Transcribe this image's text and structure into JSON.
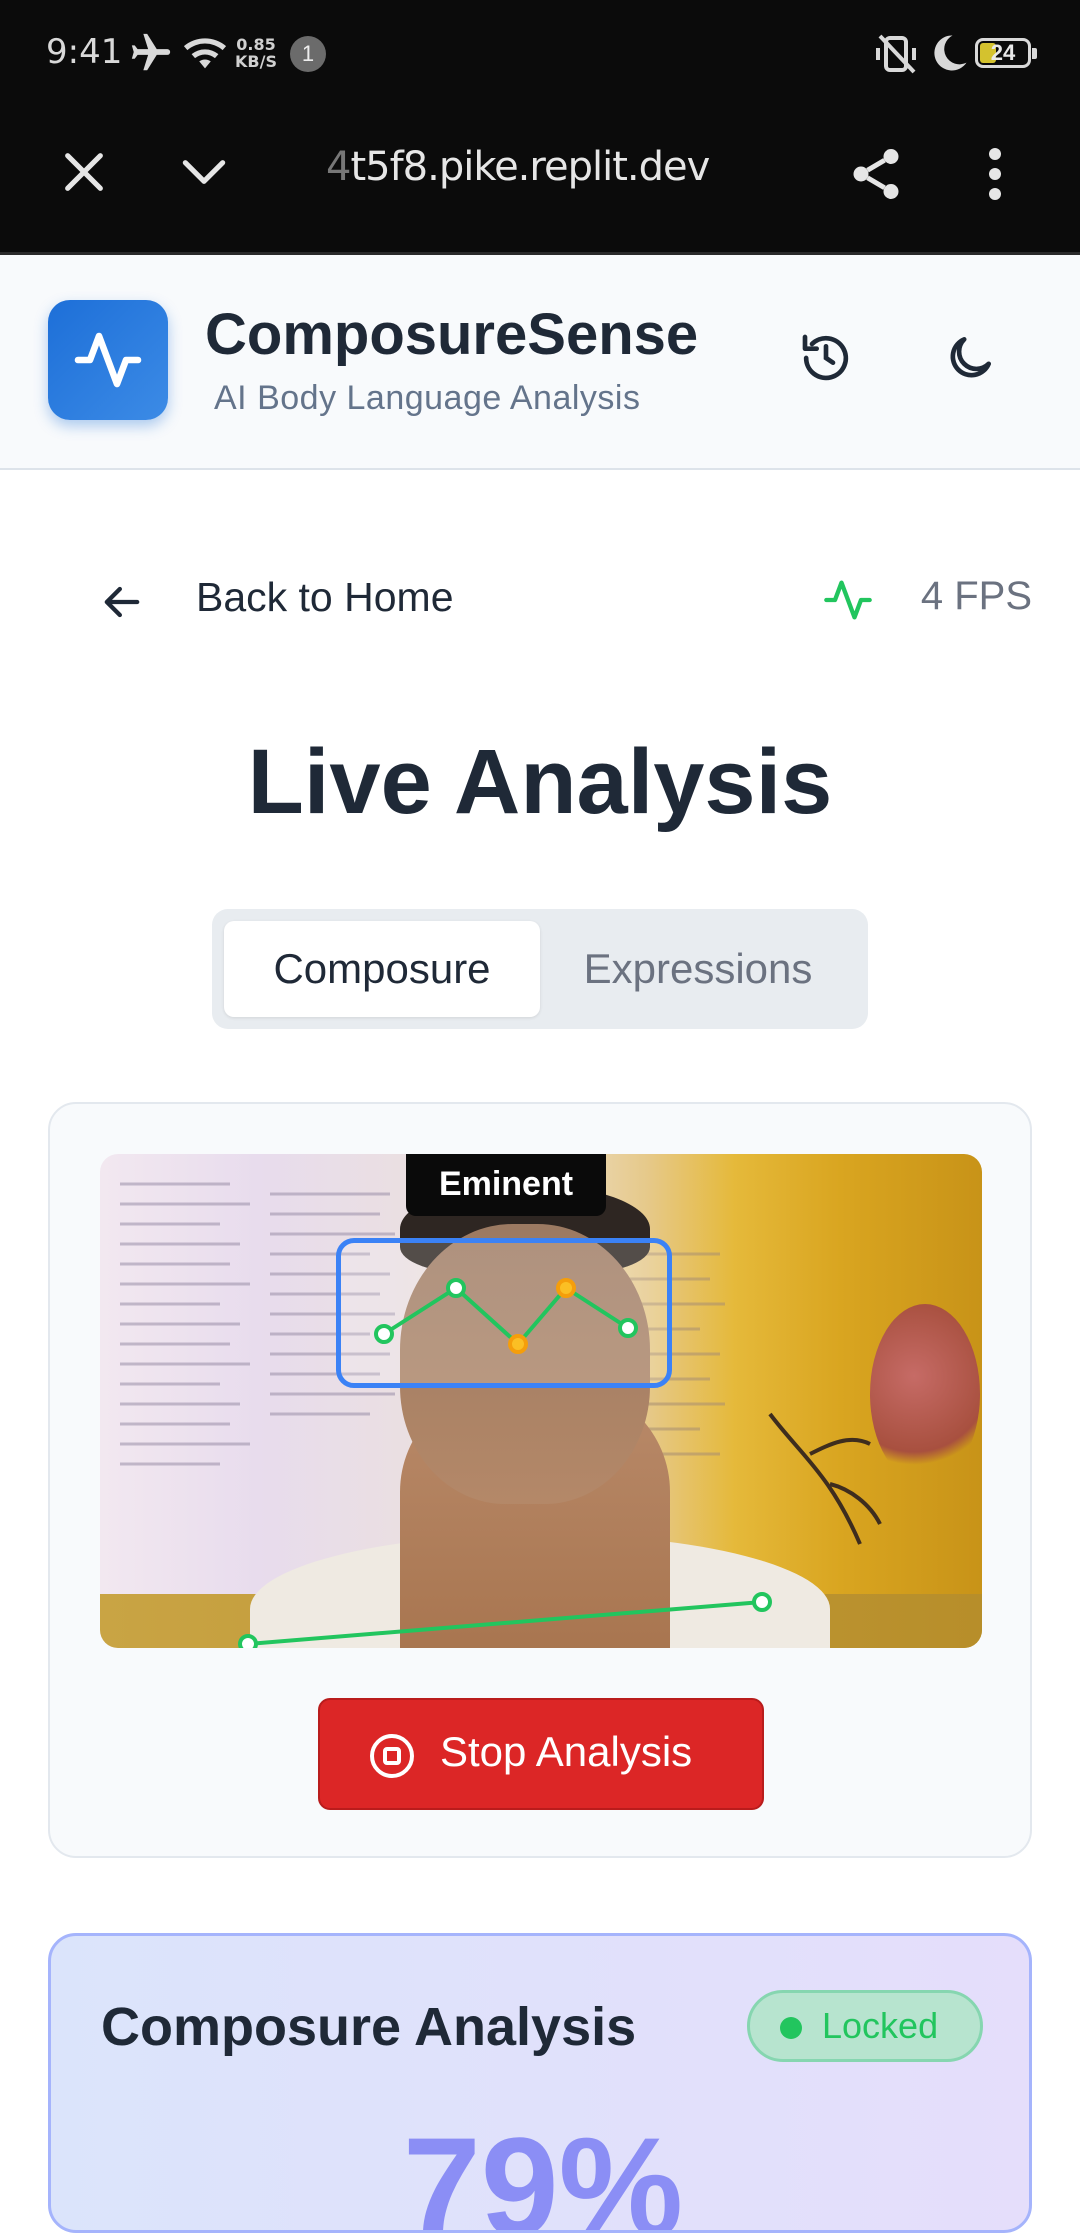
{
  "status_bar": {
    "time": "9:41",
    "net_speed_value": "0.85",
    "net_speed_unit": "KB/S",
    "notification_count": "1",
    "battery": "24"
  },
  "browser": {
    "url_faded": "4",
    "url": "t5f8.pike.replit.dev"
  },
  "header": {
    "app_name": "ComposureSense",
    "tagline": "AI Body Language Analysis"
  },
  "nav": {
    "back_label": "Back to Home",
    "fps_label": "4 FPS"
  },
  "main": {
    "title": "Live Analysis",
    "tabs": [
      {
        "label": "Composure",
        "active": true
      },
      {
        "label": "Expressions",
        "active": false
      }
    ],
    "video_label": "Eminent",
    "stop_button": "Stop Analysis"
  },
  "analysis": {
    "title": "Composure Analysis",
    "status": "Locked",
    "score": "79%"
  },
  "colors": {
    "accent": "#1d6fd8",
    "stop": "#dc2626",
    "locked": "#22c55e",
    "fps_icon": "#22c55e"
  }
}
